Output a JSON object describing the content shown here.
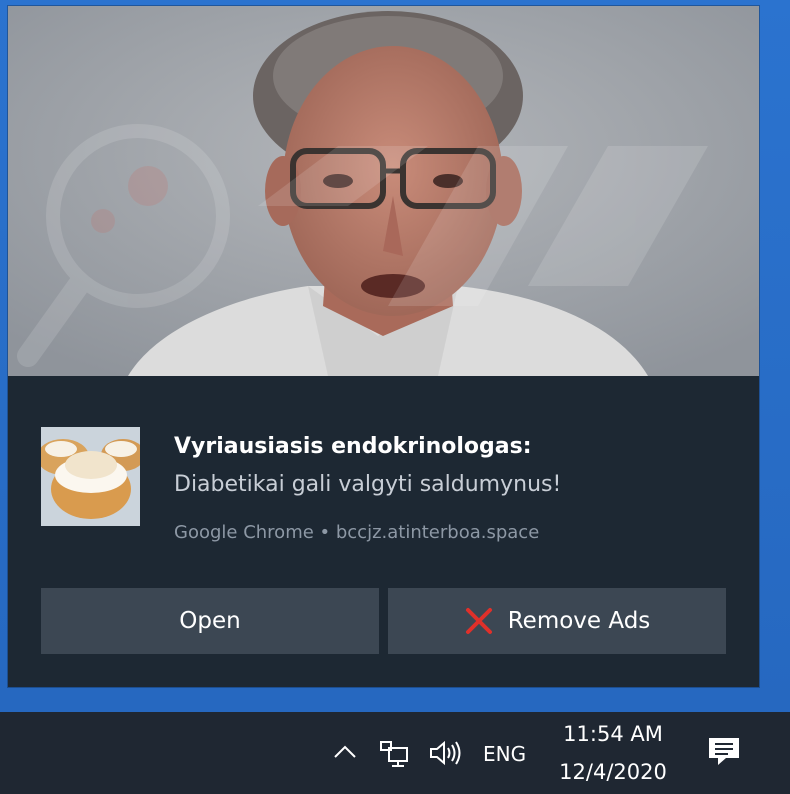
{
  "notification": {
    "title": "Vyriausiasis endokrinologas:",
    "message": "Diabetikai gali valgyti saldumynus!",
    "attribution": "Google Chrome • bccjz.atinterboa.space",
    "hero_image": "man-portrait-photo",
    "thumbnail_image": "cream-puff-pastry-photo",
    "actions": [
      {
        "label": "Open"
      },
      {
        "label": "Remove Ads",
        "icon": "red-x-icon"
      }
    ]
  },
  "taskbar": {
    "language": "ENG",
    "time": "11:54 AM",
    "date": "12/4/2020",
    "tray_icons": [
      "chevron-up-icon",
      "network-icon",
      "volume-icon",
      "action-center-icon"
    ]
  },
  "colors": {
    "desktop": "#2a6fc8",
    "toast_background": "#1d2833",
    "button_background": "#3c4753",
    "taskbar": "#1f2732",
    "remove_icon": "#e0302a"
  }
}
